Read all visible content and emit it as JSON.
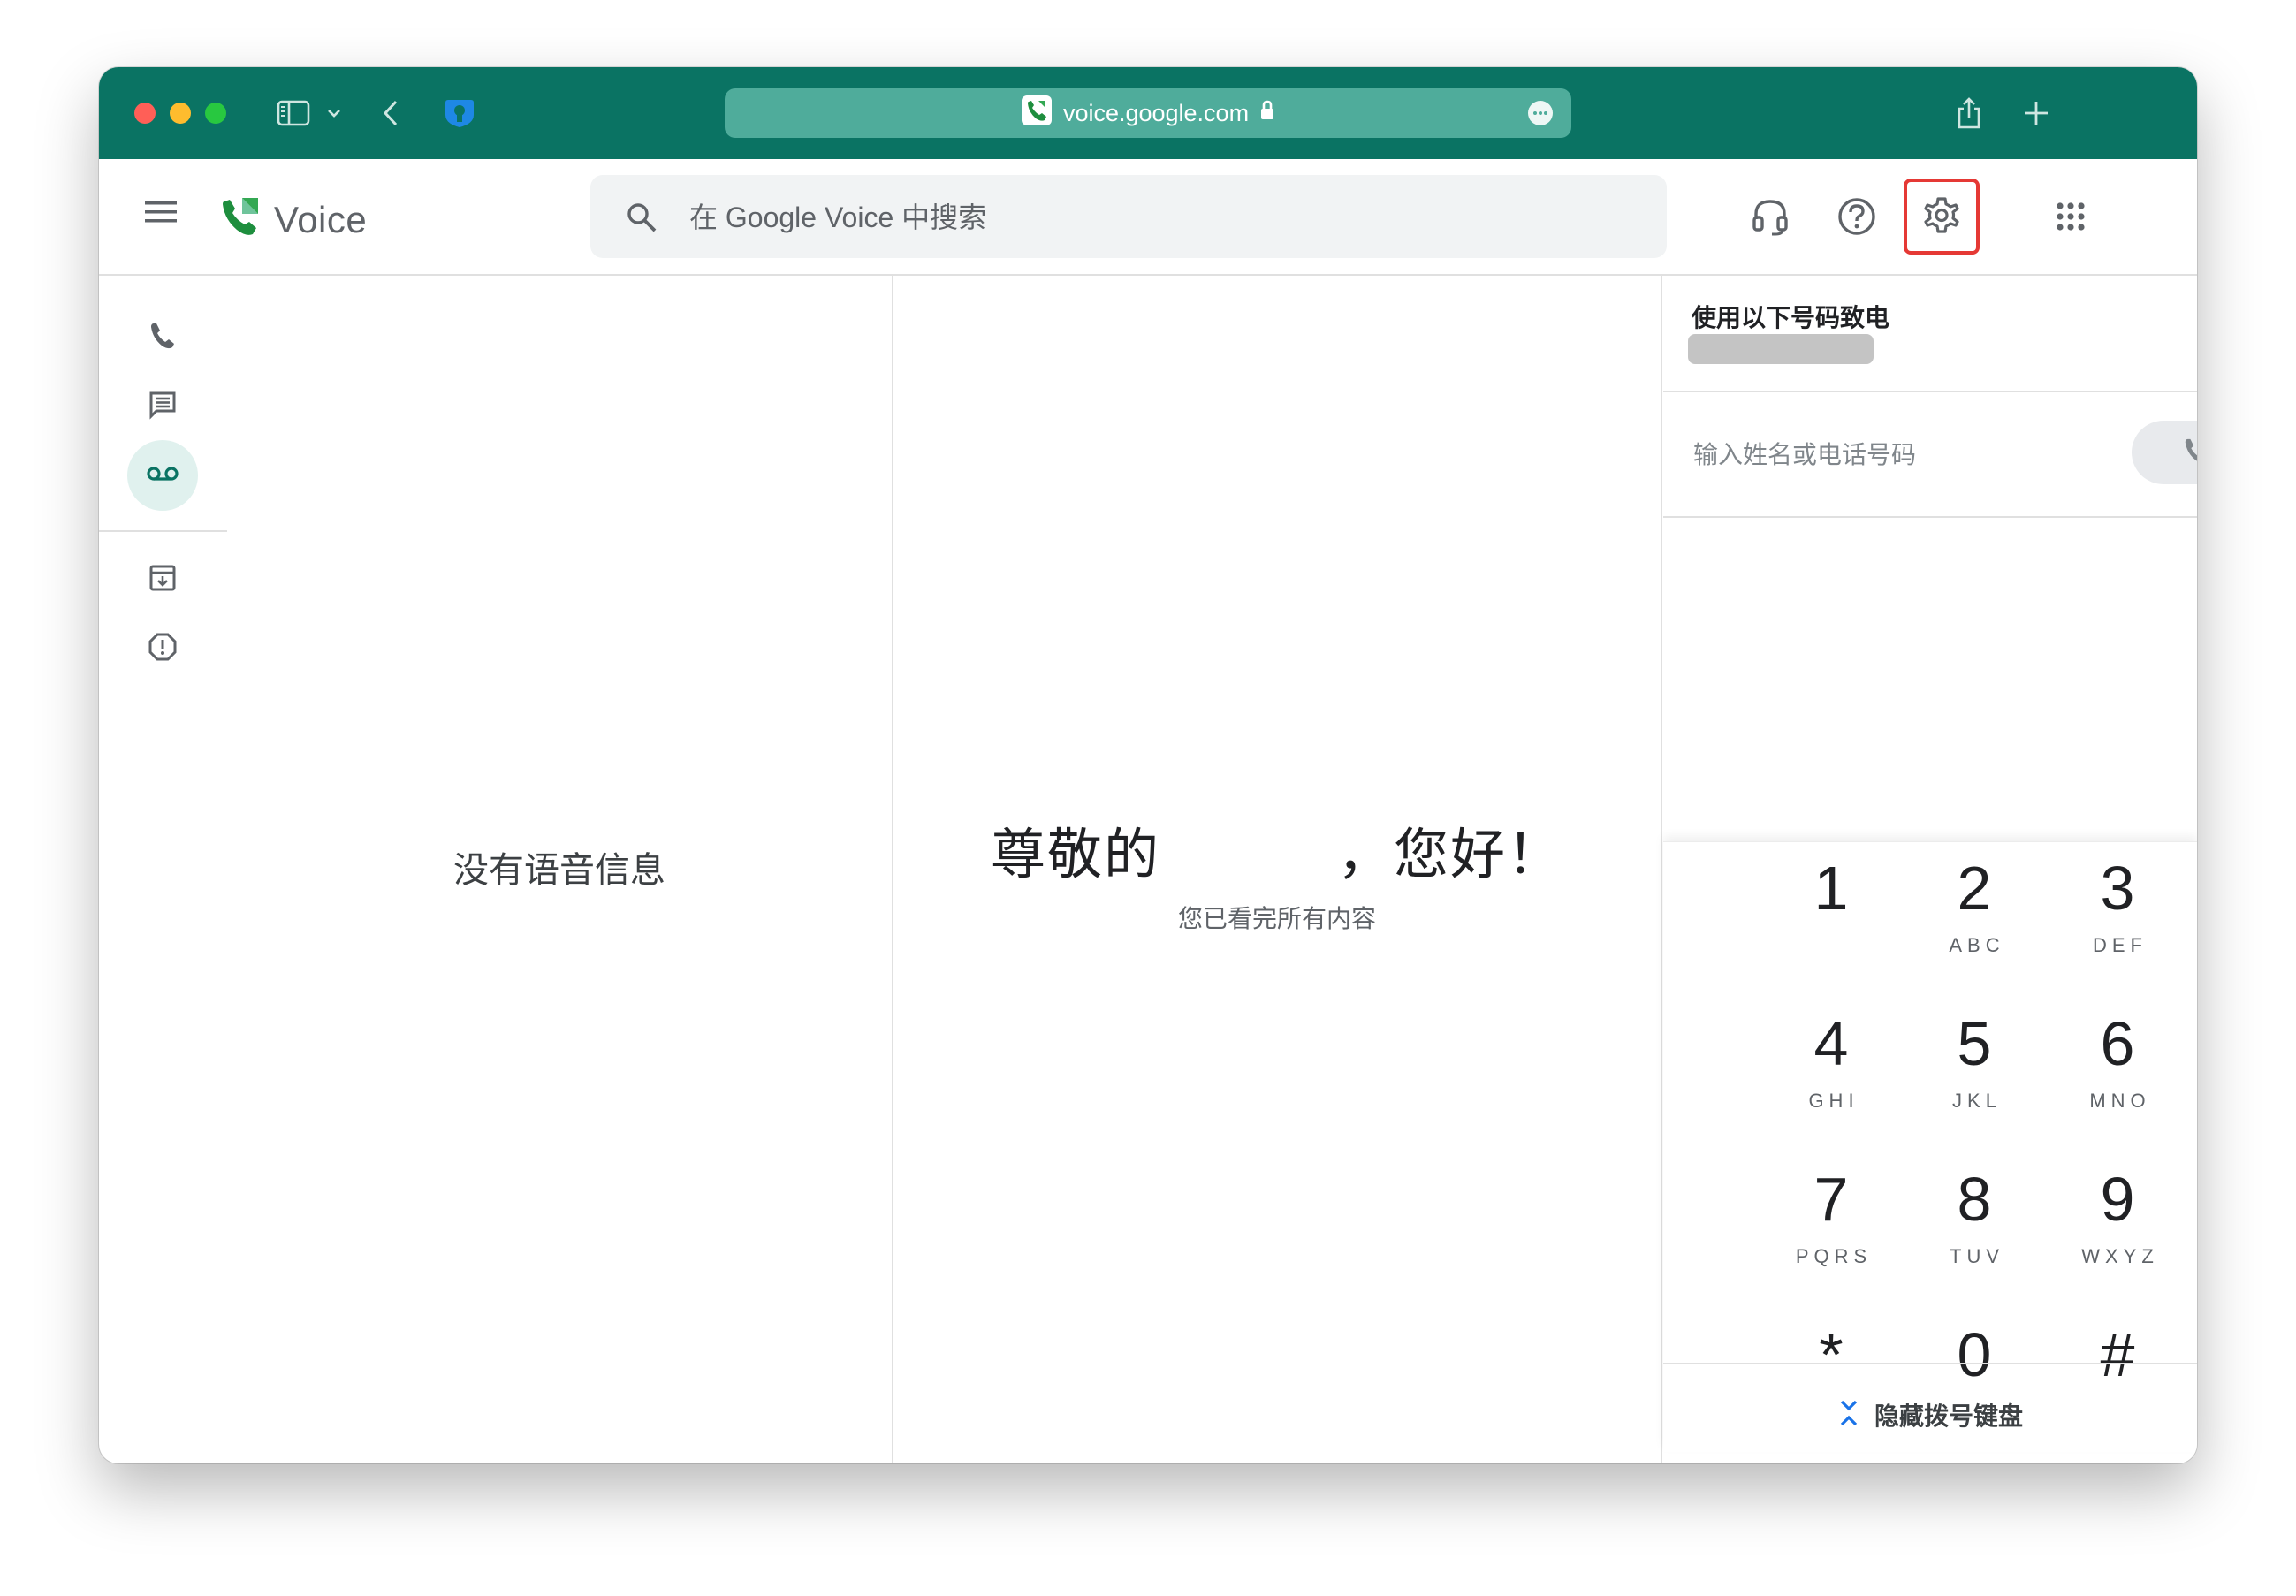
{
  "browser": {
    "url": "voice.google.com",
    "colors": {
      "titlebar": "#0a7363",
      "urlbar": "#4fac9b"
    }
  },
  "app": {
    "name": "Voice",
    "search_placeholder": "在 Google Voice 中搜索",
    "brand_color": "#0a7363"
  },
  "header": {
    "icons": [
      "headset-icon",
      "help-icon",
      "settings-icon",
      "apps-grid-icon"
    ],
    "highlighted": "settings-icon"
  },
  "nav": {
    "items": [
      {
        "name": "calls",
        "icon": "phone-icon",
        "active": false
      },
      {
        "name": "messages",
        "icon": "message-icon",
        "active": false
      },
      {
        "name": "voicemail",
        "icon": "voicemail-icon",
        "active": true
      },
      {
        "name": "archive",
        "icon": "archive-icon",
        "active": false
      },
      {
        "name": "spam",
        "icon": "spam-icon",
        "active": false
      }
    ]
  },
  "list": {
    "empty_text": "没有语音信息"
  },
  "detail": {
    "greeting_prefix": "尊敬的",
    "greeting_suffix": "，您好！",
    "subtitle": "您已看完所有内容"
  },
  "dialer": {
    "caller_label": "使用以下号码致电",
    "input_placeholder": "输入姓名或电话号码",
    "keys": [
      {
        "digit": "1",
        "letters": ""
      },
      {
        "digit": "2",
        "letters": "ABC"
      },
      {
        "digit": "3",
        "letters": "DEF"
      },
      {
        "digit": "4",
        "letters": "GHI"
      },
      {
        "digit": "5",
        "letters": "JKL"
      },
      {
        "digit": "6",
        "letters": "MNO"
      },
      {
        "digit": "7",
        "letters": "PQRS"
      },
      {
        "digit": "8",
        "letters": "TUV"
      },
      {
        "digit": "9",
        "letters": "WXYZ"
      },
      {
        "digit": "*",
        "letters": ""
      },
      {
        "digit": "0",
        "letters": ""
      },
      {
        "digit": "#",
        "letters": ""
      }
    ],
    "hide_keypad_label": "隐藏拨号键盘"
  }
}
